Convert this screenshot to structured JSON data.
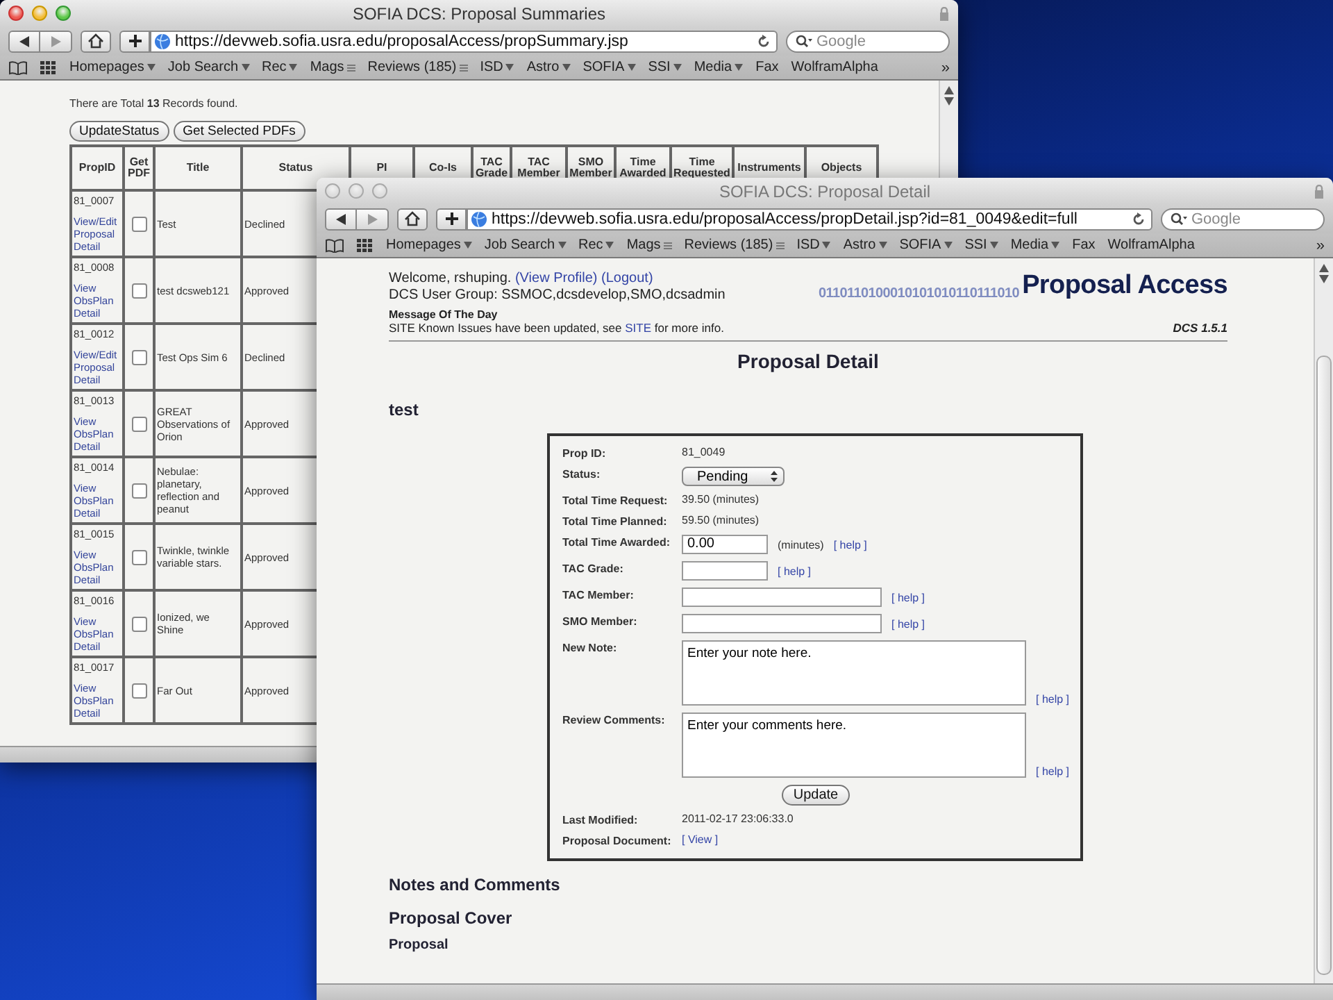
{
  "summary_window": {
    "title": "SOFIA DCS: Proposal Summaries",
    "focused": true,
    "url": "https://devweb.sofia.usra.edu/proposalAccess/propSummary.jsp",
    "search_placeholder": "Google",
    "bookmarks": [
      {
        "label": "Homepages",
        "kind": "menu"
      },
      {
        "label": "Job Search",
        "kind": "menu"
      },
      {
        "label": "Rec",
        "kind": "menu"
      },
      {
        "label": "Mags",
        "kind": "list"
      },
      {
        "label": "Reviews (185)",
        "kind": "list"
      },
      {
        "label": "ISD",
        "kind": "menu"
      },
      {
        "label": "Astro",
        "kind": "menu"
      },
      {
        "label": "SOFIA",
        "kind": "menu"
      },
      {
        "label": "SSI",
        "kind": "menu"
      },
      {
        "label": "Media",
        "kind": "menu"
      },
      {
        "label": "Fax",
        "kind": "link"
      },
      {
        "label": "WolframAlpha",
        "kind": "link"
      }
    ],
    "bookmarks_overflow": "»",
    "page": {
      "records_text": "There are Total **13** Records found.",
      "buttons": [
        "UpdateStatus",
        "Get Selected PDFs"
      ],
      "table": {
        "columns": [
          "PropID",
          "Get PDF",
          "Title",
          "Status",
          "PI",
          "Co-Is",
          "TAC Grade",
          "TAC Member",
          "SMO Member",
          "Time Awarded",
          "Time Requested",
          "Instruments",
          "Objects"
        ],
        "rows": [
          {
            "prop_id": "81_0007",
            "link": "View/Edit Proposal Detail",
            "checked": false,
            "title": "Test",
            "status": "Declined"
          },
          {
            "prop_id": "81_0008",
            "link": "View ObsPlan Detail",
            "checked": false,
            "title": "test dcsweb121",
            "status": "Approved"
          },
          {
            "prop_id": "81_0012",
            "link": "View/Edit Proposal Detail",
            "checked": false,
            "title": "Test Ops Sim 6",
            "status": "Declined"
          },
          {
            "prop_id": "81_0013",
            "link": "View ObsPlan Detail",
            "checked": false,
            "title": "GREAT Observations of Orion",
            "status": "Approved"
          },
          {
            "prop_id": "81_0014",
            "link": "View ObsPlan Detail",
            "checked": false,
            "title": "Nebulae: planetary, reflection and peanut",
            "status": "Approved"
          },
          {
            "prop_id": "81_0015",
            "link": "View ObsPlan Detail",
            "checked": false,
            "title": "Twinkle, twinkle variable stars.",
            "status": "Approved"
          },
          {
            "prop_id": "81_0016",
            "link": "View ObsPlan Detail",
            "checked": false,
            "title": "Ionized, we Shine",
            "status": "Approved"
          },
          {
            "prop_id": "81_0017",
            "link": "View ObsPlan Detail",
            "checked": false,
            "title": "Far Out",
            "status": "Approved"
          }
        ]
      }
    }
  },
  "detail_window": {
    "title": "SOFIA DCS: Proposal Detail",
    "focused": false,
    "url": "https://devweb.sofia.usra.edu/proposalAccess/propDetail.jsp?id=81_0049&edit=full",
    "search_placeholder": "Google",
    "bookmarks": [
      {
        "label": "Homepages",
        "kind": "menu"
      },
      {
        "label": "Job Search",
        "kind": "menu"
      },
      {
        "label": "Rec",
        "kind": "menu"
      },
      {
        "label": "Mags",
        "kind": "list"
      },
      {
        "label": "Reviews (185)",
        "kind": "list"
      },
      {
        "label": "ISD",
        "kind": "menu"
      },
      {
        "label": "Astro",
        "kind": "menu"
      },
      {
        "label": "SOFIA",
        "kind": "menu"
      },
      {
        "label": "SSI",
        "kind": "menu"
      },
      {
        "label": "Media",
        "kind": "menu"
      },
      {
        "label": "Fax",
        "kind": "link"
      },
      {
        "label": "WolframAlpha",
        "kind": "link"
      }
    ],
    "bookmarks_overflow": "»",
    "page": {
      "welcome": "Welcome, rshuping.",
      "welcome_links": [
        "(View Profile)",
        "(Logout)"
      ],
      "user_group": "DCS User Group: SSMOC,dcsdevelop,SMO,dcsadmin",
      "logo": {
        "digits": "0110110100010101010110111010",
        "title": "Proposal Access",
        "version": "DCS 1.5.1"
      },
      "motd": {
        "title": "Message Of The Day",
        "before": "SITE Known Issues have been updated, see",
        "link": "SITE",
        "after": "for more info."
      },
      "heading": "Proposal Detail",
      "proposal_title": "test",
      "form": [
        {
          "kind": "text",
          "label": "Prop ID:",
          "value": "81_0049"
        },
        {
          "kind": "select",
          "label": "Status:",
          "value": "Pending"
        },
        {
          "kind": "text",
          "label": "Total Time Request:",
          "value": "39.50 (minutes)"
        },
        {
          "kind": "text",
          "label": "Total Time Planned:",
          "value": "59.50 (minutes)"
        },
        {
          "kind": "input",
          "label": "Total Time Awarded:",
          "value": "0.00",
          "suffix": "(minutes)",
          "help": "[ help ]"
        },
        {
          "kind": "input",
          "label": "TAC Grade:",
          "help": "[ help ]"
        },
        {
          "kind": "long_input",
          "label": "TAC Member:",
          "help": "[ help ]"
        },
        {
          "kind": "long_input",
          "label": "SMO Member:",
          "help": "[ help ]"
        },
        {
          "kind": "textarea",
          "label": "New Note:",
          "value": "Enter your note here.",
          "help": "[ help ]"
        },
        {
          "kind": "textarea",
          "label": "Review Comments:",
          "value": "Enter your comments here.",
          "help": "[ help ]"
        },
        {
          "kind": "button",
          "label": "Update"
        },
        {
          "kind": "text",
          "label": "Last Modified:",
          "value": "2011-02-17 23:06:33.0"
        },
        {
          "kind": "link",
          "label": "Proposal Document:",
          "value": "[ View ]"
        }
      ],
      "sections": [
        "Notes and Comments",
        "Proposal Cover"
      ],
      "subsection": "Proposal"
    }
  }
}
